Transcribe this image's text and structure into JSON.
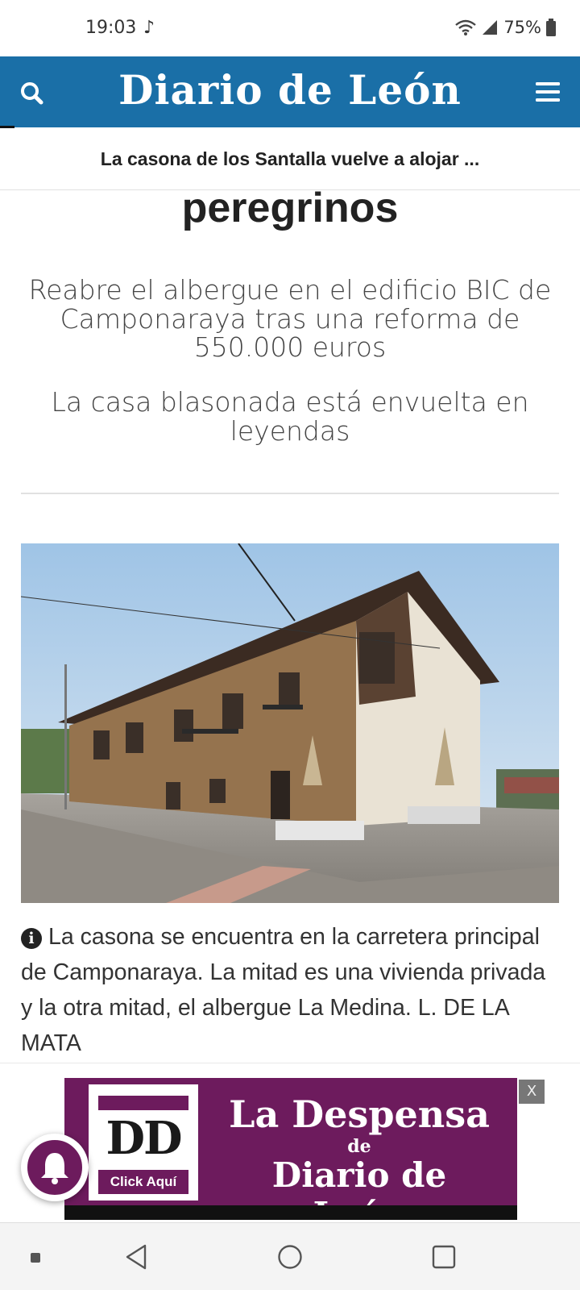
{
  "status_bar": {
    "time": "19:03",
    "battery": "75%"
  },
  "header": {
    "logo": "Diario de León"
  },
  "sticky_title": "La casona de los Santalla vuelve a alojar ...",
  "article": {
    "headline_tail": "peregrinos",
    "subhead_1": "Reabre el albergue en el edificio BIC de Camponaraya tras una reforma de 550.000 euros",
    "subhead_2": "La casa blasonada está envuelta en leyendas",
    "caption": "La casona se encuentra en la carretera principal de Camponaraya. La mitad es una vivienda privada y la otra mitad, el albergue La Medina. L. DE LA MATA"
  },
  "ad": {
    "logo_letters": "DD",
    "click_label": "Click Aquí",
    "title_line_1": "La Despensa",
    "title_line_2": "de",
    "title_line_3": "Diario de León",
    "close_label": "X"
  },
  "colors": {
    "brand_blue": "#1a6fa7",
    "ad_purple": "#6d1b5d"
  },
  "icons": {
    "header_left": "search-icon",
    "header_right": "menu-icon",
    "caption": "info-icon",
    "floating": "bell-icon",
    "nav": [
      "square-dot-icon",
      "back-icon",
      "home-icon",
      "recents-icon"
    ]
  }
}
